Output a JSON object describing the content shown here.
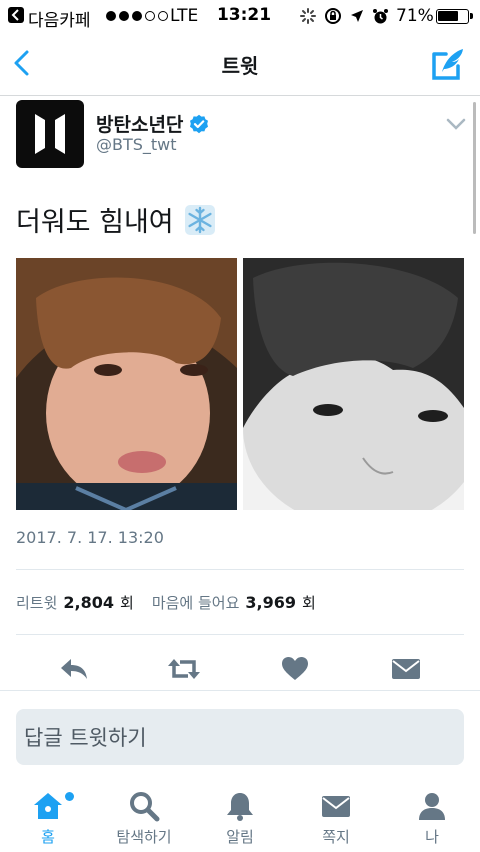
{
  "status_bar": {
    "app": "다음카페",
    "carrier": "LTE",
    "time": "13:21",
    "battery_percent_label": "71%",
    "battery_level": 0.71
  },
  "nav": {
    "title": "트윗",
    "back_icon": "chevron-left-icon",
    "compose_icon": "compose-tweet-icon"
  },
  "tweet": {
    "author_name": "방탄소년단",
    "author_handle": "@BTS_twt",
    "text": "더워도 힘내여",
    "emoji": "snowflake",
    "timestamp": "2017. 7. 17. 13:20",
    "retweets_label": "리트윗",
    "retweets_count": "2,804",
    "retweets_unit": "회",
    "likes_label": "마음에 들어요",
    "likes_count": "3,969",
    "likes_unit": "회"
  },
  "reply": {
    "placeholder": "답글 트윗하기"
  },
  "tabbar": {
    "items": [
      {
        "label": "홈",
        "icon": "home-icon",
        "active": true
      },
      {
        "label": "탐색하기",
        "icon": "search-icon",
        "active": false
      },
      {
        "label": "알림",
        "icon": "bell-icon",
        "active": false
      },
      {
        "label": "쪽지",
        "icon": "envelope-icon",
        "active": false
      },
      {
        "label": "나",
        "icon": "user-icon",
        "active": false
      }
    ]
  },
  "colors": {
    "accent": "#1da1f2",
    "icon_gray": "#657786"
  }
}
